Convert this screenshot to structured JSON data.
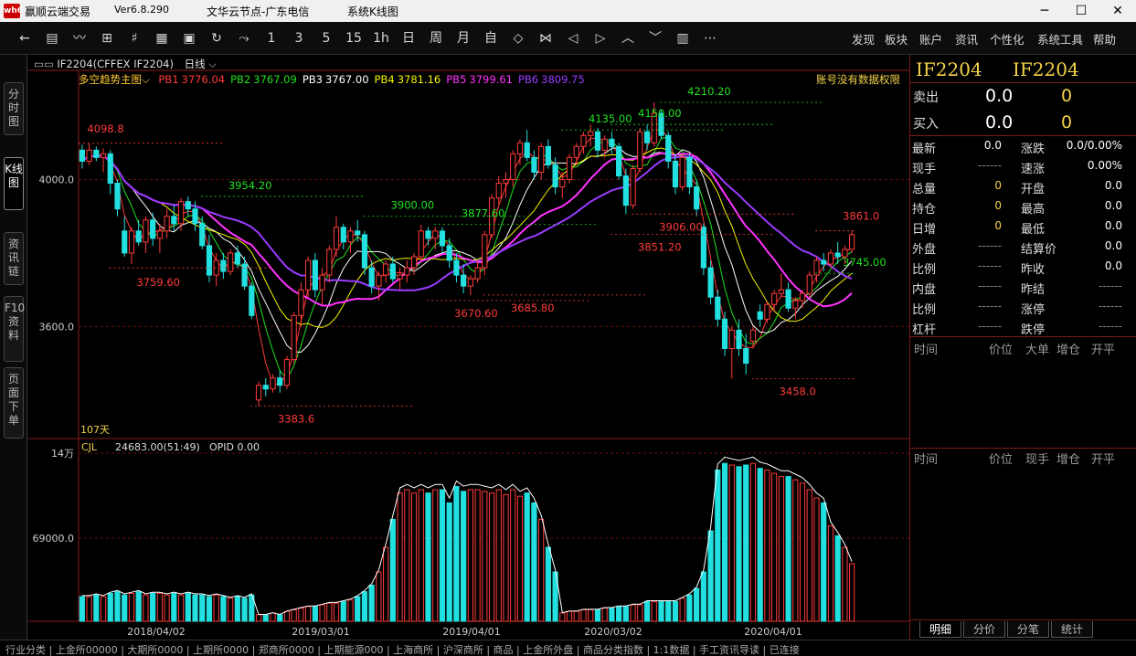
{
  "window": {
    "logo": "wh6",
    "app_name": "赢顺云端交易",
    "version": "Ver6.8.290",
    "node": "文华云节点-广东电信",
    "tool": "系统K线图"
  },
  "toolbar": {
    "buttons": [
      {
        "name": "back-icon",
        "glyph": "←"
      },
      {
        "name": "quote-list-icon",
        "glyph": "▤"
      },
      {
        "name": "line-chart-icon",
        "glyph": "〰"
      },
      {
        "name": "bar-chart-icon",
        "glyph": "⊞"
      },
      {
        "name": "candle-icon",
        "glyph": "♯"
      },
      {
        "name": "board-icon",
        "glyph": "▦"
      },
      {
        "name": "save-icon",
        "glyph": "▣"
      },
      {
        "name": "refresh-icon",
        "glyph": "↻"
      },
      {
        "name": "draw-icon",
        "glyph": "⤳"
      },
      {
        "name": "period-1m",
        "glyph": "1"
      },
      {
        "name": "period-3m",
        "glyph": "3"
      },
      {
        "name": "period-5m",
        "glyph": "5"
      },
      {
        "name": "period-15m",
        "glyph": "15"
      },
      {
        "name": "period-1h",
        "glyph": "1h"
      },
      {
        "name": "period-day",
        "glyph": "日"
      },
      {
        "name": "period-week",
        "glyph": "周"
      },
      {
        "name": "period-month",
        "glyph": "月"
      },
      {
        "name": "period-custom",
        "glyph": "自"
      },
      {
        "name": "zoom-in-icon",
        "glyph": "◇"
      },
      {
        "name": "zoom-out-icon",
        "glyph": "⋈"
      },
      {
        "name": "left-icon",
        "glyph": "◁"
      },
      {
        "name": "right-icon",
        "glyph": "▷"
      },
      {
        "name": "up-icon",
        "glyph": "︿"
      },
      {
        "name": "down-icon",
        "glyph": "﹀"
      },
      {
        "name": "layout-icon",
        "glyph": "▥"
      },
      {
        "name": "more-icon",
        "glyph": "⋯"
      }
    ],
    "menus": [
      "发现",
      "板块",
      "账户",
      "资讯",
      "个性化",
      "系统工具",
      "帮助"
    ]
  },
  "sidetabs": [
    {
      "label": "分时图",
      "active": false
    },
    {
      "label": "K线图",
      "active": true
    },
    {
      "label": "资讯链",
      "active": false
    },
    {
      "label": "F10资料",
      "active": false
    },
    {
      "label": "页面下单",
      "active": false
    }
  ],
  "chart_header": {
    "contract": "IF2204(CFFEX IF2204)",
    "period": "日线",
    "indicator_name": "多空趋势主图",
    "pb": [
      {
        "label": "PB1",
        "value": "3776.04",
        "color": "#ff3a3a"
      },
      {
        "label": "PB2",
        "value": "3767.09",
        "color": "#20e020"
      },
      {
        "label": "PB3",
        "value": "3767.00",
        "color": "#ffffff"
      },
      {
        "label": "PB4",
        "value": "3781.16",
        "color": "#f5f500"
      },
      {
        "label": "PB5",
        "value": "3799.61",
        "color": "#ff33ff"
      },
      {
        "label": "PB6",
        "value": "3809.75",
        "color": "#9a3cff"
      }
    ],
    "no_auth": "账号没有数据权限",
    "days_label": "107天",
    "vol_label": "CJL",
    "vol_value": "24683.00(51:49)",
    "opid": "OPID 0.00"
  },
  "chart_data": {
    "type": "candlestick",
    "price_axis": {
      "ticks": [
        "4000.0",
        "3600.0"
      ],
      "range": [
        3300,
        4250
      ]
    },
    "volume_axis": {
      "ticks": [
        "14万",
        "69000.0"
      ]
    },
    "date_labels": [
      "2018/04/02",
      "2019/03/01",
      "2019/04/01",
      "2020/03/02",
      "2020/04/01"
    ],
    "annotations": [
      {
        "text": "4098.8",
        "color": "#ff3a3a"
      },
      {
        "text": "3759.60",
        "color": "#ff3a3a"
      },
      {
        "text": "3954.20",
        "color": "#20e020"
      },
      {
        "text": "3900.00",
        "color": "#20e020"
      },
      {
        "text": "3877.60",
        "color": "#20e020"
      },
      {
        "text": "3670.60",
        "color": "#ff3a3a"
      },
      {
        "text": "3685.80",
        "color": "#ff3a3a"
      },
      {
        "text": "3383.6",
        "color": "#ff3a3a"
      },
      {
        "text": "4135.00",
        "color": "#20e020"
      },
      {
        "text": "4150.00",
        "color": "#20e020"
      },
      {
        "text": "4210.20",
        "color": "#20e020"
      },
      {
        "text": "3851.20",
        "color": "#ff3a3a"
      },
      {
        "text": "3906.00",
        "color": "#ff3a3a"
      },
      {
        "text": "3745.00",
        "color": "#20e020"
      },
      {
        "text": "3861.0",
        "color": "#ff3a3a"
      },
      {
        "text": "3458.0",
        "color": "#ff3a3a"
      }
    ],
    "candles": [
      [
        4080,
        4095,
        4030,
        4050
      ],
      [
        4050,
        4098,
        4040,
        4080
      ],
      [
        4080,
        4090,
        4050,
        4060
      ],
      [
        4060,
        4085,
        4020,
        4070
      ],
      [
        4070,
        4080,
        3960,
        3990
      ],
      [
        3990,
        4000,
        3900,
        3920
      ],
      [
        3860,
        3900,
        3790,
        3800
      ],
      [
        3800,
        3870,
        3770,
        3860
      ],
      [
        3860,
        3890,
        3820,
        3830
      ],
      [
        3830,
        3900,
        3800,
        3890
      ],
      [
        3890,
        3910,
        3820,
        3840
      ],
      [
        3840,
        3880,
        3800,
        3860
      ],
      [
        3860,
        3920,
        3840,
        3900
      ],
      [
        3900,
        3930,
        3860,
        3880
      ],
      [
        3880,
        3950,
        3860,
        3940
      ],
      [
        3940,
        3954,
        3900,
        3920
      ],
      [
        3920,
        3940,
        3860,
        3880
      ],
      [
        3880,
        3900,
        3810,
        3820
      ],
      [
        3820,
        3850,
        3720,
        3740
      ],
      [
        3740,
        3800,
        3710,
        3780
      ],
      [
        3780,
        3800,
        3730,
        3750
      ],
      [
        3750,
        3810,
        3740,
        3800
      ],
      [
        3800,
        3820,
        3760,
        3770
      ],
      [
        3770,
        3790,
        3700,
        3710
      ],
      [
        3710,
        3720,
        3620,
        3630
      ],
      [
        3400,
        3450,
        3383,
        3440
      ],
      [
        3440,
        3460,
        3410,
        3430
      ],
      [
        3430,
        3470,
        3420,
        3460
      ],
      [
        3460,
        3480,
        3420,
        3440
      ],
      [
        3440,
        3520,
        3430,
        3510
      ],
      [
        3510,
        3640,
        3500,
        3630
      ],
      [
        3630,
        3720,
        3600,
        3700
      ],
      [
        3700,
        3790,
        3680,
        3780
      ],
      [
        3780,
        3800,
        3680,
        3700
      ],
      [
        3700,
        3760,
        3660,
        3740
      ],
      [
        3740,
        3820,
        3720,
        3810
      ],
      [
        3810,
        3900,
        3790,
        3870
      ],
      [
        3870,
        3880,
        3810,
        3830
      ],
      [
        3830,
        3870,
        3800,
        3860
      ],
      [
        3860,
        3890,
        3830,
        3850
      ],
      [
        3850,
        3860,
        3740,
        3760
      ],
      [
        3760,
        3780,
        3690,
        3710
      ],
      [
        3710,
        3750,
        3670,
        3740
      ],
      [
        3740,
        3780,
        3720,
        3770
      ],
      [
        3770,
        3790,
        3720,
        3730
      ],
      [
        3730,
        3760,
        3700,
        3740
      ],
      [
        3740,
        3780,
        3720,
        3760
      ],
      [
        3760,
        3800,
        3740,
        3790
      ],
      [
        3790,
        3877,
        3780,
        3860
      ],
      [
        3860,
        3870,
        3820,
        3840
      ],
      [
        3840,
        3870,
        3810,
        3860
      ],
      [
        3860,
        3870,
        3800,
        3820
      ],
      [
        3820,
        3840,
        3760,
        3780
      ],
      [
        3780,
        3800,
        3720,
        3740
      ],
      [
        3740,
        3770,
        3690,
        3710
      ],
      [
        3710,
        3740,
        3685,
        3730
      ],
      [
        3730,
        3780,
        3720,
        3760
      ],
      [
        3760,
        3860,
        3740,
        3850
      ],
      [
        3850,
        3960,
        3840,
        3950
      ],
      [
        3950,
        4010,
        3930,
        3990
      ],
      [
        3990,
        4020,
        3950,
        4000
      ],
      [
        4000,
        4080,
        3980,
        4070
      ],
      [
        4070,
        4110,
        4040,
        4100
      ],
      [
        4100,
        4135,
        4050,
        4060
      ],
      [
        4060,
        4080,
        4000,
        4020
      ],
      [
        4020,
        4100,
        4000,
        4090
      ],
      [
        4090,
        4110,
        4030,
        4040
      ],
      [
        4040,
        4060,
        3960,
        3980
      ],
      [
        3980,
        4020,
        3950,
        4000
      ],
      [
        4000,
        4070,
        3990,
        4060
      ],
      [
        4060,
        4100,
        4040,
        4090
      ],
      [
        4090,
        4130,
        4070,
        4120
      ],
      [
        4120,
        4150,
        4090,
        4130
      ],
      [
        4130,
        4140,
        4060,
        4080
      ],
      [
        4080,
        4120,
        4060,
        4110
      ],
      [
        4110,
        4130,
        4070,
        4090
      ],
      [
        4090,
        4100,
        4000,
        4010
      ],
      [
        4010,
        4030,
        3906,
        3930
      ],
      [
        3930,
        4040,
        3920,
        4030
      ],
      [
        4030,
        4140,
        4020,
        4130
      ],
      [
        4130,
        4150,
        4080,
        4100
      ],
      [
        4100,
        4210,
        4090,
        4180
      ],
      [
        4180,
        4190,
        4110,
        4120
      ],
      [
        4120,
        4130,
        4030,
        4050
      ],
      [
        4050,
        4070,
        3960,
        3980
      ],
      [
        3980,
        4070,
        3970,
        4060
      ],
      [
        4060,
        4070,
        3960,
        3980
      ],
      [
        3980,
        4000,
        3900,
        3920
      ],
      [
        3870,
        3880,
        3740,
        3760
      ],
      [
        3760,
        3780,
        3660,
        3680
      ],
      [
        3680,
        3700,
        3600,
        3620
      ],
      [
        3620,
        3640,
        3520,
        3540
      ],
      [
        3540,
        3600,
        3458,
        3590
      ],
      [
        3590,
        3620,
        3520,
        3540
      ],
      [
        3540,
        3580,
        3470,
        3500
      ],
      [
        3560,
        3600,
        3540,
        3590
      ],
      [
        3640,
        3660,
        3600,
        3620
      ],
      [
        3620,
        3670,
        3610,
        3660
      ],
      [
        3660,
        3700,
        3640,
        3690
      ],
      [
        3690,
        3745,
        3680,
        3700
      ],
      [
        3700,
        3720,
        3640,
        3650
      ],
      [
        3650,
        3680,
        3620,
        3670
      ],
      [
        3670,
        3700,
        3650,
        3690
      ],
      [
        3690,
        3750,
        3680,
        3740
      ],
      [
        3740,
        3790,
        3720,
        3780
      ],
      [
        3780,
        3800,
        3750,
        3770
      ],
      [
        3770,
        3810,
        3760,
        3800
      ],
      [
        3800,
        3830,
        3770,
        3790
      ],
      [
        3790,
        3820,
        3770,
        3810
      ],
      [
        3810,
        3861,
        3800,
        3850
      ]
    ],
    "volumes": [
      0.15,
      0.15,
      0.16,
      0.15,
      0.17,
      0.18,
      0.16,
      0.17,
      0.18,
      0.16,
      0.17,
      0.17,
      0.16,
      0.17,
      0.16,
      0.17,
      0.16,
      0.16,
      0.15,
      0.16,
      0.15,
      0.14,
      0.15,
      0.14,
      0.16,
      0.04,
      0.04,
      0.05,
      0.04,
      0.06,
      0.07,
      0.08,
      0.09,
      0.09,
      0.1,
      0.11,
      0.11,
      0.12,
      0.13,
      0.15,
      0.18,
      0.22,
      0.3,
      0.45,
      0.62,
      0.78,
      0.8,
      0.78,
      0.8,
      0.78,
      0.8,
      0.8,
      0.72,
      0.82,
      0.79,
      0.8,
      0.8,
      0.79,
      0.78,
      0.8,
      0.77,
      0.8,
      0.76,
      0.78,
      0.72,
      0.62,
      0.45,
      0.3,
      0.05,
      0.06,
      0.06,
      0.07,
      0.07,
      0.07,
      0.08,
      0.08,
      0.09,
      0.09,
      0.1,
      0.1,
      0.12,
      0.12,
      0.12,
      0.12,
      0.12,
      0.14,
      0.16,
      0.2,
      0.3,
      0.55,
      0.92,
      0.96,
      0.95,
      0.94,
      0.95,
      0.96,
      0.93,
      0.92,
      0.9,
      0.88,
      0.88,
      0.86,
      0.84,
      0.8,
      0.75,
      0.72,
      0.58,
      0.52,
      0.45,
      0.35,
      0.15,
      0.1
    ]
  },
  "quote_panel": {
    "symbol": "IF2204",
    "symbol2": "IF2204",
    "sell": {
      "label": "卖出",
      "price": "0.0",
      "qty": "0"
    },
    "buy": {
      "label": "买入",
      "price": "0.0",
      "qty": "0"
    },
    "rows": [
      {
        "l1": "最新",
        "v1": "0.0",
        "l2": "涨跌",
        "v2": "0.0/0.00%"
      },
      {
        "l1": "现手",
        "v1": "------",
        "l2": "速涨",
        "v2": "0.00%"
      },
      {
        "l1": "总量",
        "v1": "0",
        "l2": "开盘",
        "v2": "0.0"
      },
      {
        "l1": "持仓",
        "v1": "0",
        "l2": "最高",
        "v2": "0.0"
      },
      {
        "l1": "日增",
        "v1": "0",
        "l2": "最低",
        "v2": "0.0"
      },
      {
        "l1": "外盘",
        "v1": "------",
        "l2": "结算价",
        "v2": "0.0"
      },
      {
        "l1": "比例",
        "v1": "------",
        "l2": "昨收",
        "v2": "0.0"
      },
      {
        "l1": "内盘",
        "v1": "------",
        "l2": "昨结",
        "v2": "------"
      },
      {
        "l1": "比例",
        "v1": "------",
        "l2": "涨停",
        "v2": "------"
      },
      {
        "l1": "杠杆",
        "v1": "------",
        "l2": "跌停",
        "v2": "------"
      }
    ],
    "table1_cols": [
      "时间",
      "价位",
      "大单",
      "增仓",
      "开平"
    ],
    "table2_cols": [
      "时间",
      "价位",
      "现手",
      "增仓",
      "开平"
    ],
    "tabs": [
      "明细",
      "分价",
      "分笔",
      "统计"
    ]
  },
  "statusbar": {
    "text": "行业分类 | 上金所00000 | 大期所0000 | 上期所0000 | 郑商所0000 | 上期能源000 | 上海商所 | 沪深商所 | 商品 | 上金所外盘 | 商品分类指数 | 1:1数据 | 手工资讯导读 | 已连接"
  }
}
